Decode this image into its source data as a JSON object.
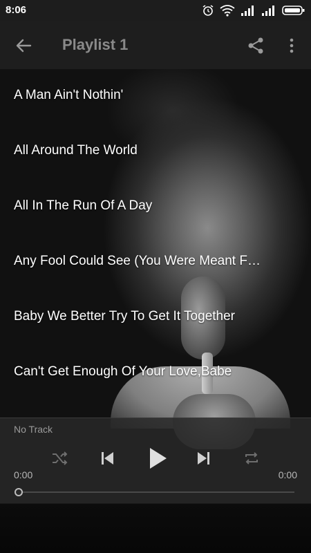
{
  "status_bar": {
    "time": "8:06",
    "icons": [
      "alarm-icon",
      "wifi-icon",
      "signal-icon",
      "signal-icon",
      "battery-icon"
    ]
  },
  "app_bar": {
    "title": "Playlist 1",
    "back_icon": "arrow-left-icon",
    "share_icon": "share-icon",
    "more_icon": "more-vertical-icon"
  },
  "tracks": [
    {
      "title": "A Man Ain't Nothin'"
    },
    {
      "title": "All Around The World"
    },
    {
      "title": "All In The Run Of A Day"
    },
    {
      "title": "Any Fool Could See (You Were Meant For Me)"
    },
    {
      "title": "Baby We Better Try To Get It Together"
    },
    {
      "title": "Can't Get Enough Of Your Love,Babe"
    }
  ],
  "player": {
    "now_playing": "No Track",
    "elapsed": "0:00",
    "duration": "0:00",
    "progress": 0,
    "controls": [
      "shuffle-icon",
      "previous-icon",
      "play-icon",
      "next-icon",
      "repeat-icon"
    ]
  },
  "colors": {
    "app_bar_bg": "#1e1e1e",
    "title_color": "#8a8a8a",
    "track_text": "#ffffff",
    "player_bg": "#282828"
  }
}
